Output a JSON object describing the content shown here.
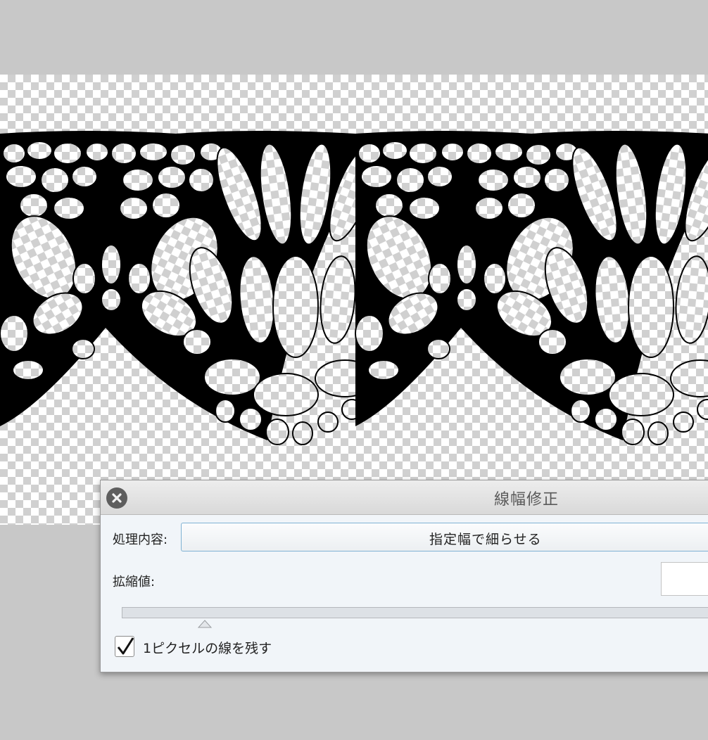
{
  "dialog": {
    "title": "線幅修正",
    "process_label": "処理内容:",
    "process_value": "指定幅で細らせる",
    "scale_label": "拡縮値:",
    "scale_value": "",
    "checkbox_label": "1ピクセルの線を残す",
    "checkbox_checked": true
  },
  "icons": {
    "close": "close-icon",
    "check": "checkmark-icon",
    "slider_thumb": "triangle-up-icon"
  },
  "colors": {
    "workspace_bg": "#c8c8c8",
    "dialog_bg": "#f1f5f9",
    "dropdown_border": "#7fb2d3",
    "lace": "#000000"
  }
}
